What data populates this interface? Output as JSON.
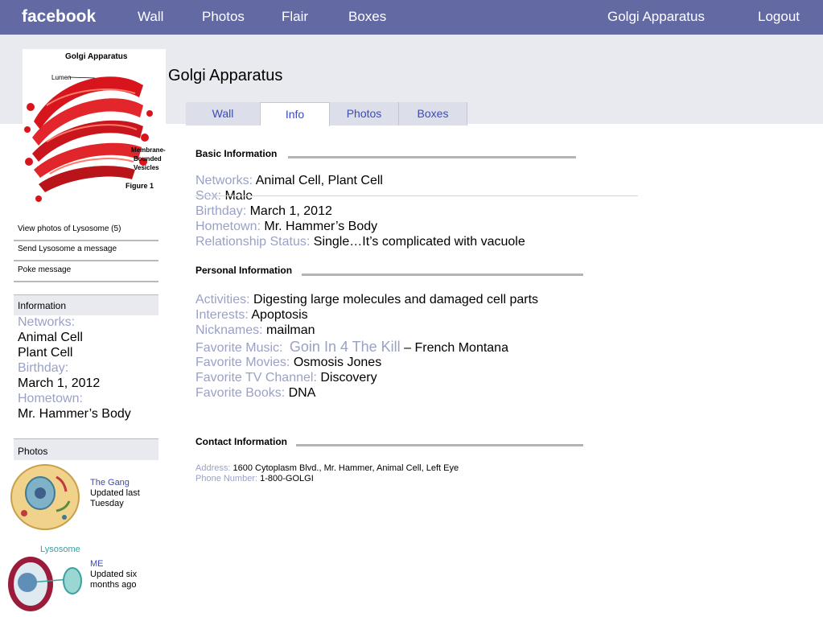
{
  "topbar": {
    "logo": "facebook",
    "nav": [
      "Wall",
      "Photos",
      "Flair",
      "Boxes"
    ],
    "profile_link": "Golgi Apparatus",
    "logout": "Logout"
  },
  "profile": {
    "name": "Golgi Apparatus",
    "photo_caption": {
      "title": "Golgi Apparatus",
      "lumen": "Lumen",
      "vesicles": [
        "Membrane-",
        "Bounded",
        "Vesicles"
      ],
      "figure": "Figure 1"
    }
  },
  "tabs": [
    "Wall",
    "Info",
    "Photos",
    "Boxes"
  ],
  "active_tab": "Info",
  "sidebar": {
    "links": [
      "View photos of Lysosome (5)",
      "Send Lysosome a message",
      "Poke message"
    ],
    "info_header": "Information",
    "info": [
      {
        "label": "Networks:",
        "values": [
          "Animal Cell",
          "Plant Cell"
        ]
      },
      {
        "label": "Birthday:",
        "values": [
          "March 1, 2012"
        ]
      },
      {
        "label": "Hometown:",
        "values": [
          "Mr. Hammer’s Body"
        ]
      }
    ],
    "photos_header": "Photos",
    "albums": [
      {
        "name": "The Gang",
        "updated": [
          "Updated last",
          "Tuesday"
        ]
      },
      {
        "name": "ME",
        "updated": [
          "Updated six",
          "months ago"
        ],
        "thumb_label": "Lysosome"
      }
    ]
  },
  "basic": {
    "title": "Basic Information",
    "rows": [
      {
        "label": "Networks:",
        "value": "Animal Cell, Plant Cell"
      },
      {
        "label": "Sex:",
        "value": "Male"
      },
      {
        "label": "Birthday:",
        "value": "March 1, 2012"
      },
      {
        "label": "Hometown:",
        "value": "Mr. Hammer’s Body"
      },
      {
        "label": "Relationship Status:",
        "value": "Single…It’s complicated with vacuole"
      }
    ]
  },
  "personal": {
    "title": "Personal Information",
    "activities": {
      "label": "Activities:",
      "value": "Digesting large molecules and damaged cell parts"
    },
    "interests": {
      "label": "Interests:",
      "value": "Apoptosis"
    },
    "nicknames": {
      "label": "Nicknames:",
      "value": "mailman"
    },
    "music": {
      "label": "Favorite Music:",
      "song": "Goin In 4 The Kill",
      "artist": "– French Montana"
    },
    "movies": {
      "label": "Favorite Movies:",
      "value": "Osmosis Jones"
    },
    "tv": {
      "label": "Favorite TV Channel:",
      "value": "Discovery"
    },
    "books": {
      "label": "Favorite Books:",
      "value": "DNA"
    }
  },
  "contact": {
    "title": "Contact Information",
    "address": {
      "label": "Address:",
      "value": "1600 Cytoplasm Blvd., Mr. Hammer, Animal Cell, Left Eye"
    },
    "phone": {
      "label": "Phone Number:",
      "value": "1-800-GOLGI"
    }
  },
  "colors": {
    "topbar": "#6269a3",
    "band": "#e9eaf0",
    "label": "#9aa1c8",
    "link": "#3b4bb8"
  }
}
